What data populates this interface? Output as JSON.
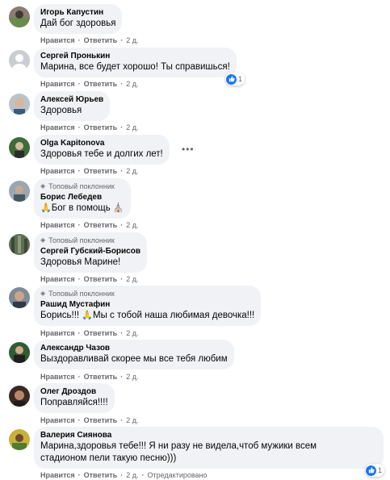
{
  "colors": {
    "bubble": "#f0f2f5",
    "meta": "#65676b",
    "like": "#1877f2",
    "text": "#050505"
  },
  "actions": {
    "like": "Нравится",
    "reply": "Ответить",
    "separator": "·"
  },
  "comments": [
    {
      "author": "Игорь Капустин",
      "text": "Дай бог здоровья",
      "time": "2 д."
    },
    {
      "author": "Сергей Пронькин",
      "text": "Марина, все будет хорошо! Ты справишься!",
      "time": "2 д.",
      "reactions": "1",
      "reaction_icon": "like-icon"
    },
    {
      "author": "Алексей Юрьев",
      "text": "Здоровья",
      "time": "2 д."
    },
    {
      "author": "Olga Kapitonova",
      "text": "Здоровья тебе и долгих лет!",
      "time": "2 д.",
      "more_icon": "more-options-icon"
    },
    {
      "badge": "Топовый поклонник",
      "author": "Борис Лебедев",
      "text_emoji": "🙏",
      "text": "Бог в помощь",
      "text_emoji_end": "⛪",
      "time": "2 д."
    },
    {
      "badge": "Топовый поклонник",
      "author": "Сергей Губский-Борисов",
      "text": "Здоровья Марине!",
      "time": "2 д."
    },
    {
      "badge": "Топовый поклонник",
      "author": "Рашид Мустафин",
      "text_before": "Борись!!!",
      "text_emoji": "🙏",
      "text": "Мы с тобой наша любимая девочка!!!",
      "time": "2 д."
    },
    {
      "author": "Александр Чазов",
      "text": "Выздоравливай скорее мы все тебя любим",
      "time": "2 д."
    },
    {
      "author": "Олег Дроздов",
      "text": "Поправляйся!!!!",
      "time": "2 д."
    },
    {
      "author": "Валерия Сиянова",
      "text_line1": "Марина,здоровья тебе!!! Я ни разу не видела,чтоб мужики всем",
      "text_line2": "стадионом пели такую песню)))",
      "time": "2 д.",
      "edited": "Отредактировано",
      "reactions": "1",
      "reaction_icon": "like-icon"
    }
  ]
}
